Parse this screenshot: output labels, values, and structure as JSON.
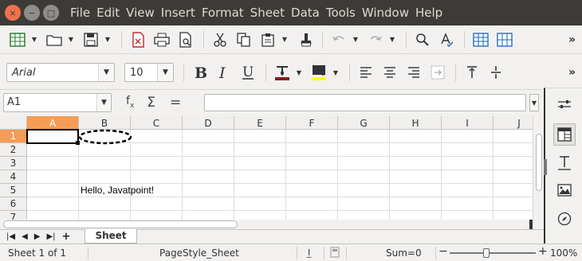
{
  "menu": {
    "items": [
      "File",
      "Edit",
      "View",
      "Insert",
      "Format",
      "Sheet",
      "Data",
      "Tools",
      "Window",
      "Help"
    ]
  },
  "window_controls": {
    "close_glyph": "×",
    "minimize_glyph": "−",
    "maximize_glyph": "□"
  },
  "toolbar": {
    "more_glyph": "»",
    "font_name": "Arial",
    "font_size": "10",
    "font_color": "#8b1a1a",
    "highlight_color": "#ffff00"
  },
  "formula_bar": {
    "cell_reference": "A1",
    "formula": ""
  },
  "grid": {
    "columns": [
      "A",
      "B",
      "C",
      "D",
      "E",
      "F",
      "G",
      "H",
      "I",
      "J"
    ],
    "rows": [
      "1",
      "2",
      "3",
      "4",
      "5",
      "6",
      "7"
    ],
    "active_column": "A",
    "active_row": "1",
    "cells": {
      "B5": "Hello, Javatpoint!"
    }
  },
  "sheet_tabs": {
    "tabs": [
      "Sheet"
    ],
    "active": "Sheet",
    "add_glyph": "+"
  },
  "status": {
    "sheet_position": "Sheet 1 of 1",
    "page_style": "PageStyle_Sheet",
    "sum": "Sum=0",
    "zoom": "100%",
    "zoom_minus": "−",
    "zoom_plus": "+"
  },
  "colors": {
    "accent_header": "#f59d56",
    "menubar_bg": "#3c3b37"
  }
}
